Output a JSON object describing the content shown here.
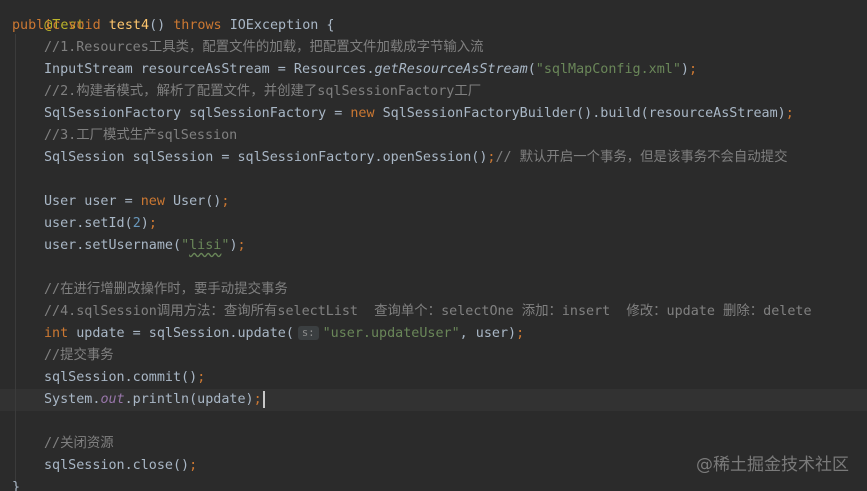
{
  "colors": {
    "background": "#2b2b2b",
    "default_text": "#a9b7c6",
    "keyword": "#cc7832",
    "method_declaration": "#ffc66d",
    "comment": "#808080",
    "string": "#6a8759",
    "number": "#6897bb",
    "annotation": "#bbb529",
    "static_field": "#9876aa"
  },
  "code": {
    "l1": {
      "annotation": "@Test"
    },
    "l2": {
      "kw_public": "public",
      "kw_void": "void",
      "method": "test4",
      "params": "()",
      "kw_throws": "throws",
      "rest": "IOException {"
    },
    "l3": {
      "comment": "//1.Resources工具类，配置文件的加载，把配置文件加载成字节输入流"
    },
    "l4": {
      "pre": "InputStream resourceAsStream = Resources.",
      "call": "getResourceAsStream",
      "open": "(",
      "string": "\"sqlMapConfig.xml\"",
      "close": ")",
      "semi": ";"
    },
    "l5": {
      "comment": "//2.构建者模式，解析了配置文件，并创建了sqlSessionFactory工厂"
    },
    "l6": {
      "pre": "SqlSessionFactory sqlSessionFactory = ",
      "kw_new": "new",
      "rest": " SqlSessionFactoryBuilder().build(resourceAsStream)",
      "semi": ";"
    },
    "l7": {
      "comment": "//3.工厂模式生产sqlSession"
    },
    "l8": {
      "code": "SqlSession sqlSession = sqlSessionFactory.openSession()",
      "semi": ";",
      "comment": "// 默认开启一个事务，但是该事务不会自动提交"
    },
    "l10": {
      "pre": "User user = ",
      "kw_new": "new",
      "rest": " User()",
      "semi": ";"
    },
    "l11": {
      "pre": "user.setId(",
      "number": "2",
      "close": ")",
      "semi": ";"
    },
    "l12": {
      "pre": "user.setUsername(",
      "q1": "\"",
      "string": "lisi",
      "q2": "\"",
      "close": ")",
      "semi": ";"
    },
    "l14": {
      "comment": "//在进行增删改操作时，要手动提交事务"
    },
    "l15": {
      "comment": "//4.sqlSession调用方法：查询所有selectList  查询单个：selectOne 添加：insert  修改：update 删除：delete"
    },
    "l16": {
      "kw_int": "int",
      "pre": " update = sqlSession.update(",
      "hint": "s:",
      "string": "\"user.updateUser\"",
      "rest": ", user)",
      "semi": ";"
    },
    "l17": {
      "comment": "//提交事务"
    },
    "l18": {
      "pre": "sqlSession.commit()",
      "semi": ";"
    },
    "l19": {
      "pre": "System.",
      "field": "out",
      "rest": ".println(update)",
      "semi": ";"
    },
    "l21": {
      "comment": "//关闭资源"
    },
    "l22": {
      "pre": "sqlSession.close()",
      "semi": ";"
    },
    "l23": {
      "brace": "}"
    }
  },
  "watermark": "@稀土掘金技术社区"
}
